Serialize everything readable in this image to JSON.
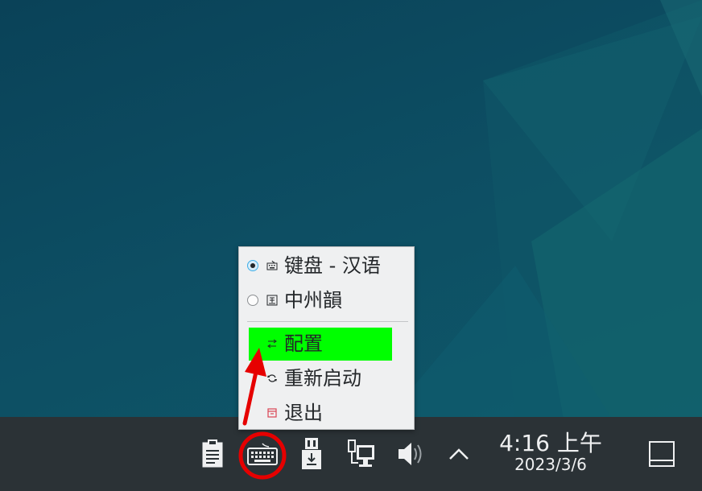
{
  "menu": {
    "input_methods": [
      {
        "label": "键盘 - 汉语",
        "selected": true,
        "icon": "keyboard-icon"
      },
      {
        "label": "中州韻",
        "selected": false,
        "icon": "rime-icon"
      }
    ],
    "actions": [
      {
        "label": "配置",
        "icon": "configure-icon",
        "highlighted": true
      },
      {
        "label": "重新启动",
        "icon": "restart-icon"
      },
      {
        "label": "退出",
        "icon": "exit-icon"
      }
    ]
  },
  "taskbar": {
    "tray_icons": [
      "clipboard-icon",
      "keyboard-icon",
      "usb-drive-icon",
      "network-icon",
      "volume-icon",
      "expand-arrow-icon"
    ],
    "clock": {
      "time": "4:16 上午",
      "date": "2023/3/6"
    },
    "show_desktop_icon": "show-desktop-icon"
  },
  "colors": {
    "desktop_bg": "#0e4a60",
    "panel_bg": "#2b3236",
    "menu_bg": "#eff0f1",
    "highlight": "#00ff00",
    "annotation_red": "#e60000",
    "radio_accent": "#3daee9"
  }
}
